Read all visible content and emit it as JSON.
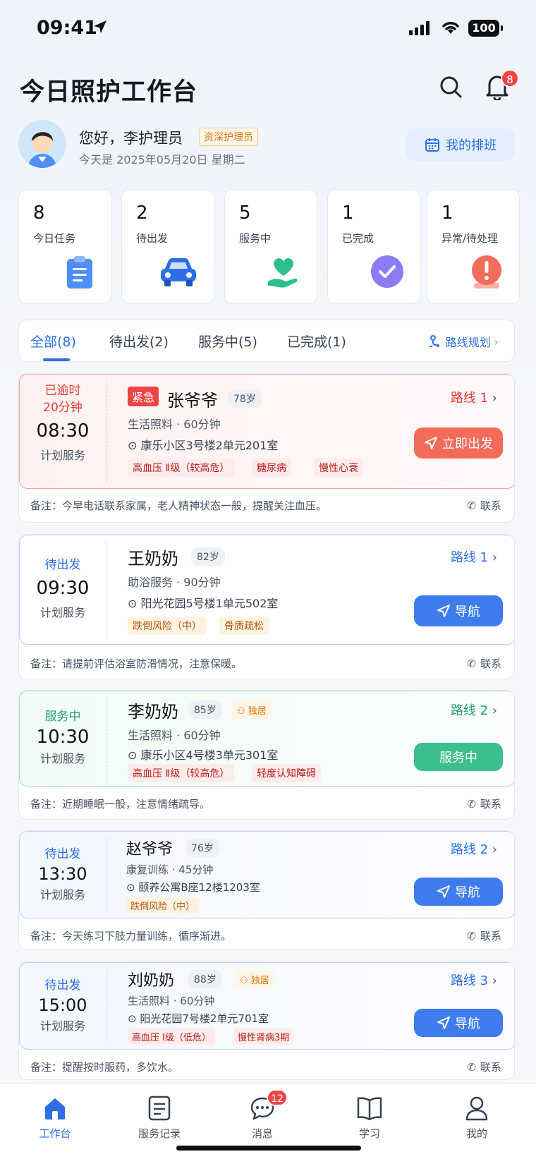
{
  "status_bar": {
    "time": "09:41",
    "battery": "100"
  },
  "header": {
    "title": "今日照护工作台",
    "notification_count": "8"
  },
  "user": {
    "greeting": "您好，李护理员",
    "role": "资深护理员",
    "date": "今天是 2025年05月20日 星期二",
    "schedule_button": "我的排班"
  },
  "stats": [
    {
      "value": "8",
      "label": "今日任务",
      "icon": "clipboard-icon",
      "color": "#4f8ef7"
    },
    {
      "value": "2",
      "label": "待出发",
      "icon": "car-icon",
      "color": "#2f6fe6"
    },
    {
      "value": "5",
      "label": "服务中",
      "icon": "heart-hand-icon",
      "color": "#2bbf8f"
    },
    {
      "value": "1",
      "label": "已完成",
      "icon": "check-circle-icon",
      "color": "#8b7cf6"
    },
    {
      "value": "1",
      "label": "异常/待处理",
      "icon": "alert-icon",
      "color": "#f26b5b"
    }
  ],
  "tabs": {
    "items": [
      "全部(8)",
      "待出发(2)",
      "服务中(5)",
      "已完成(1)"
    ],
    "route_planning": "路线规划"
  },
  "tasks": [
    {
      "status_lines": [
        "已逾时",
        "20分钟"
      ],
      "time": "08:30",
      "plan": "计划服务",
      "urgent": "紧急",
      "name": "张爷爷",
      "age": "78岁",
      "alone": "",
      "service": "生活照料 · 60分钟",
      "address": "康乐小区3号楼2单元201室",
      "tags": [
        "高血压 Ⅱ级（较高危）",
        "糖尿病",
        "慢性心衰"
      ],
      "route": "路线 1",
      "action": "立即出发",
      "note": "备注：今早电话联系家属，老人精神状态一般，提醒关注血压。",
      "contact": "联系",
      "accent": "#ef5350"
    },
    {
      "status_lines": [
        "待出发"
      ],
      "time": "09:30",
      "plan": "计划服务",
      "urgent": "",
      "name": "王奶奶",
      "age": "82岁",
      "alone": "",
      "service": "助浴服务 · 90分钟",
      "address": "阳光花园5号楼1单元502室",
      "tags": [
        "跌倒风险（中）",
        "骨质疏松"
      ],
      "route": "路线 1",
      "action": "导航",
      "note": "备注：请提前评估浴室防滑情况，注意保暖。",
      "contact": "联系",
      "accent": "#2f6fe6"
    },
    {
      "status_lines": [
        "服务中"
      ],
      "time": "10:30",
      "plan": "计划服务",
      "urgent": "",
      "name": "李奶奶",
      "age": "85岁",
      "alone": "独居",
      "service": "生活照料 · 60分钟",
      "address": "康乐小区4号楼3单元301室",
      "tags": [
        "高血压 Ⅱ级（较高危）",
        "轻度认知障碍"
      ],
      "route": "路线 2",
      "action": "服务中",
      "note": "备注：近期睡眠一般，注意情绪疏导。",
      "contact": "联系",
      "accent": "#22a06b"
    },
    {
      "status_lines": [
        "待出发"
      ],
      "time": "13:30",
      "plan": "计划服务",
      "urgent": "",
      "name": "赵爷爷",
      "age": "76岁",
      "alone": "",
      "service": "康复训练 · 45分钟",
      "address": "颐养公寓B座12楼1203室",
      "tags": [
        "跌倒风险（中）"
      ],
      "route": "路线 2",
      "action": "导航",
      "note": "备注：今天练习下肢力量训练，循序渐进。",
      "contact": "联系",
      "accent": "#2f6fe6"
    },
    {
      "status_lines": [
        "待出发"
      ],
      "time": "15:00",
      "plan": "计划服务",
      "urgent": "",
      "name": "刘奶奶",
      "age": "88岁",
      "alone": "独居",
      "service": "生活照料 · 60分钟",
      "address": "阳光花园7号楼2单元701室",
      "tags": [
        "高血压 Ⅰ级（低危）",
        "慢性肾病3期"
      ],
      "route": "路线 3",
      "action": "导航",
      "note": "备注：提醒按时服药，多饮水。",
      "contact": "联系",
      "accent": "#2f6fe6"
    }
  ],
  "tabbar": {
    "items": [
      {
        "label": "工作台",
        "icon": "home-icon"
      },
      {
        "label": "服务记录",
        "icon": "document-icon"
      },
      {
        "label": "消息",
        "icon": "chat-icon"
      },
      {
        "label": "学习",
        "icon": "book-icon"
      },
      {
        "label": "我的",
        "icon": "person-icon"
      }
    ],
    "message_badge": "12"
  }
}
